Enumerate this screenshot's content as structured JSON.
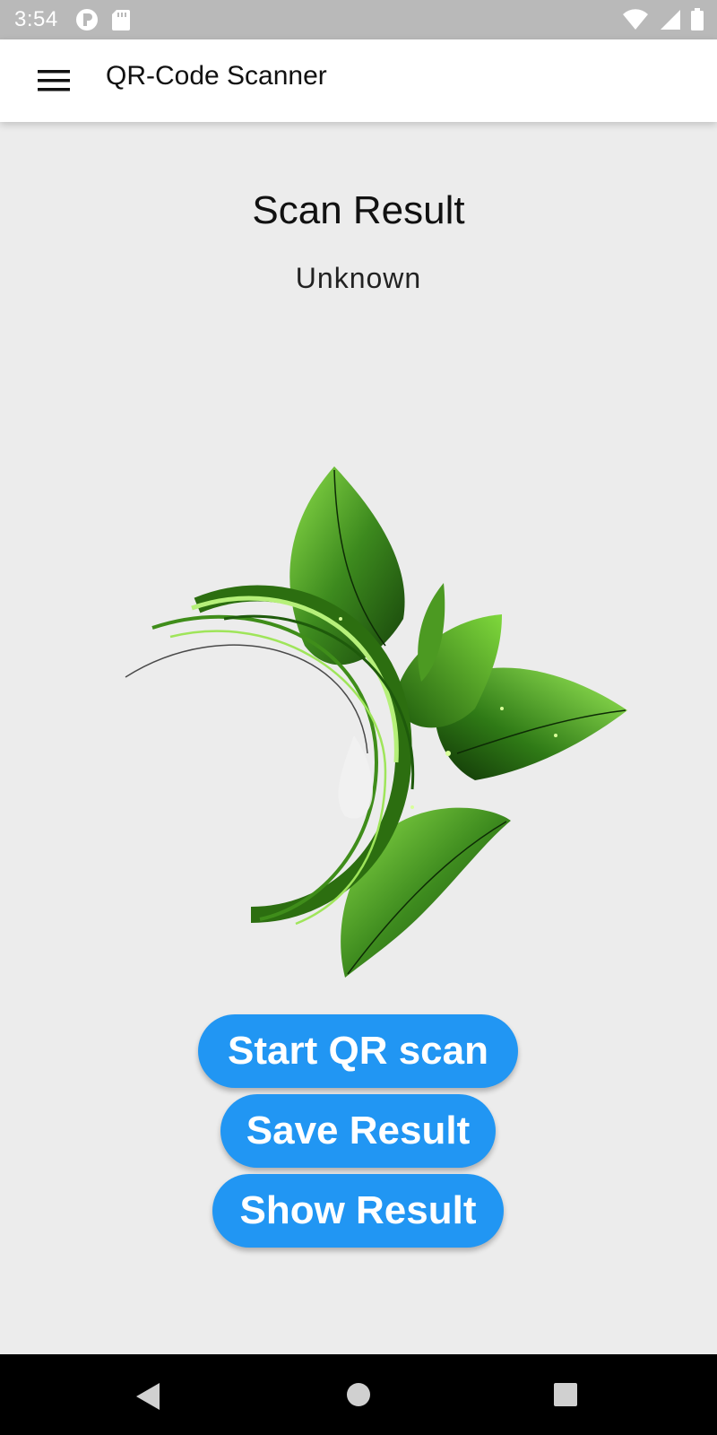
{
  "status_bar": {
    "time": "3:54",
    "left_icons": [
      "notification-app-icon",
      "sd-card-icon"
    ],
    "right_icons": [
      "wifi-icon",
      "signal-icon",
      "battery-icon"
    ]
  },
  "app_bar": {
    "menu_icon": "hamburger-menu-icon",
    "title": "QR-Code Scanner"
  },
  "main": {
    "heading": "Scan Result",
    "result_value": "Unknown",
    "illustration": "green-leaves-illustration",
    "buttons": {
      "start_scan": "Start QR scan",
      "save_result": "Save Result",
      "show_result": "Show Result"
    }
  },
  "nav_bar": {
    "back_icon": "back-triangle-icon",
    "home_icon": "home-circle-icon",
    "recents_icon": "recents-square-icon"
  },
  "colors": {
    "accent": "#2196f3",
    "background": "#ececec",
    "status_bar": "#b9b9b9",
    "nav_bar": "#000000"
  }
}
